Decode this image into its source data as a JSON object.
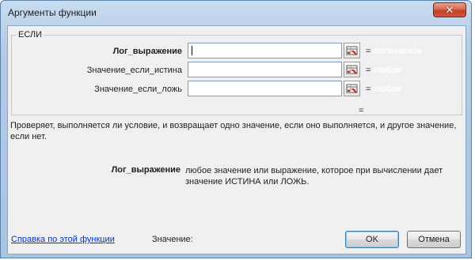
{
  "window": {
    "title": "Аргументы функции",
    "close_label": "✕"
  },
  "function_group": {
    "name": "ЕСЛИ",
    "arguments": [
      {
        "label": "Лог_выражение",
        "value": "",
        "eq": "=",
        "hint": "логическое"
      },
      {
        "label": "Значение_если_истина",
        "value": "",
        "eq": "=",
        "hint": "любое"
      },
      {
        "label": "Значение_если_ложь",
        "value": "",
        "eq": "=",
        "hint": "любое"
      }
    ],
    "result_eq": "="
  },
  "description": "Проверяет, выполняется ли условие, и возвращает одно значение, если оно выполняется, и другое значение, если нет.",
  "argument_help": {
    "name": "Лог_выражение",
    "text": "любое значение или выражение, которое при вычислении дает значение ИСТИНА или ЛОЖЬ."
  },
  "footer": {
    "help_link": "Справка по этой функции",
    "value_label": "Значение:",
    "ok_label": "OK",
    "cancel_label": "Отмена"
  },
  "icons": {
    "collapse": "range-select-icon",
    "close": "close-icon"
  }
}
